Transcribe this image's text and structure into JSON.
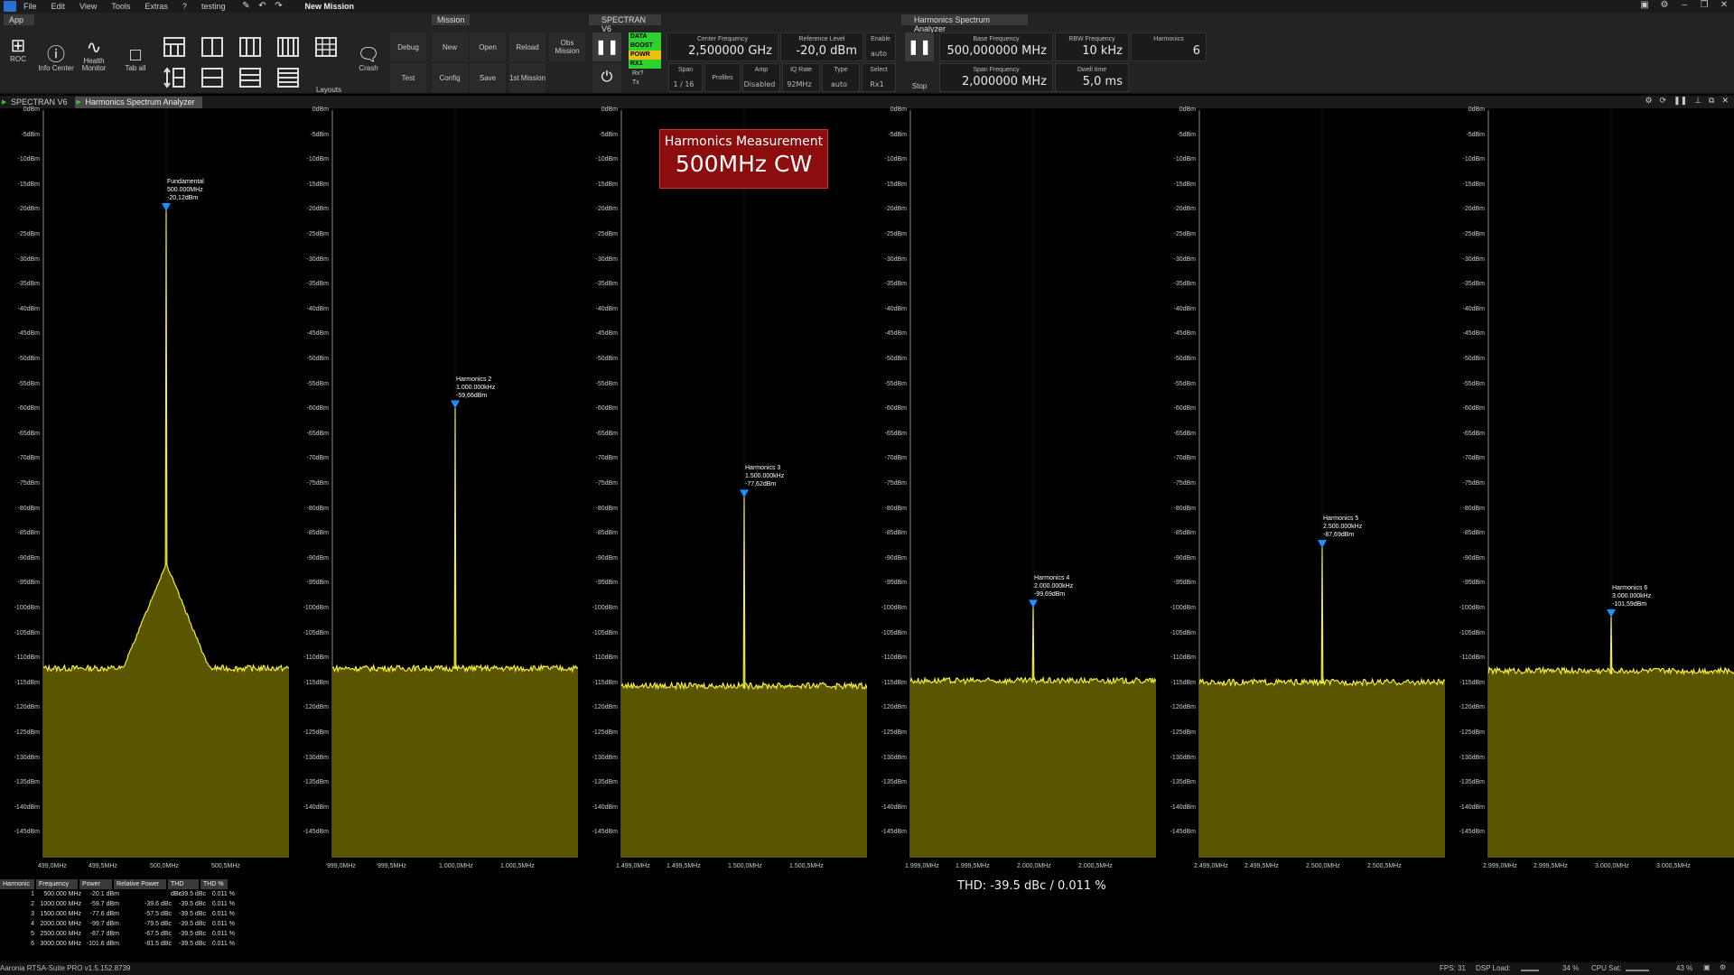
{
  "menu": {
    "items": [
      "File",
      "Edit",
      "View",
      "Tools",
      "Extras",
      "?",
      "testing"
    ],
    "mission_name": "New Mission"
  },
  "toolbar": {
    "app_group": "App",
    "mission_group": "Mission",
    "spectran_group": "SPECTRAN V6",
    "harmonics_group": "Harmonics Spectrum Analyzer",
    "app_buttons": [
      {
        "label": "ROC",
        "icon": "network-icon"
      },
      {
        "label": "Info Center",
        "icon": "info-icon"
      },
      {
        "label": "Health Monitor",
        "icon": "pulse-icon"
      },
      {
        "label": "Tab all",
        "icon": "single-layout-icon"
      }
    ],
    "layout_label": "Layouts",
    "crash_label": "Crash",
    "debug_label": "Debug",
    "test_label": "Test",
    "mission_buttons": [
      "New",
      "Open",
      "Reload",
      "Obs Mission",
      "Config",
      "Save",
      "1st Mission"
    ],
    "status_leds": [
      {
        "label": "DATA",
        "color": "#2fd12f"
      },
      {
        "label": "BOOST",
        "color": "#2fd12f"
      },
      {
        "label": "POWR",
        "color": "#e8c20d"
      },
      {
        "label": "RX1",
        "color": "#2fd12f"
      }
    ],
    "rx_label": "Rx?",
    "tx_label": "Tx",
    "center_frequency": {
      "label": "Center Frequency",
      "value": "2,500000 GHz"
    },
    "reference_level": {
      "label": "Reference Level",
      "value": "-20,0 dBm"
    },
    "enable": {
      "label": "Enable",
      "value": "auto"
    },
    "span": {
      "label": "Span",
      "value": "1 / 16"
    },
    "profiles": {
      "label": "Profiles"
    },
    "amp": {
      "label": "Amp",
      "value": "Disabled"
    },
    "iq_rate": {
      "label": "IQ Rate",
      "value": "92MHz"
    },
    "type": {
      "label": "Type",
      "value": "auto"
    },
    "select": {
      "label": "Select",
      "value": "Rx1"
    },
    "stop_label": "Stop",
    "base_frequency": {
      "label": "Base Frequency",
      "value": "500,000000 MHz"
    },
    "rbw_frequency": {
      "label": "RBW Frequency",
      "value": "10 kHz"
    },
    "harmonics": {
      "label": "Harmonics",
      "value": "6"
    },
    "span_frequency": {
      "label": "Span Frequency",
      "value": "2,000000 MHz"
    },
    "dwell_time": {
      "label": "Dwell time",
      "value": "5,0 ms"
    }
  },
  "tabs": [
    {
      "label": "SPECTRAN V6"
    },
    {
      "label": "Harmonics Spectrum Analyzer"
    }
  ],
  "overlay": {
    "line1": "Harmonics Measurement",
    "line2": "500MHz CW"
  },
  "thd_text": "THD: -39.5 dBc / 0.011 %",
  "table": {
    "headers": [
      "Harmonic",
      "Frequency",
      "Power",
      "Relative Power",
      "THD dBc",
      "THD %"
    ],
    "rows": [
      [
        "1",
        "500.000 MHz",
        "-20.1 dBm",
        "",
        "-39.5 dBc",
        "0.011 %"
      ],
      [
        "2",
        "1000.000 MHz",
        "-59.7 dBm",
        "-39.6 dBc",
        "-39.5 dBc",
        "0.011 %"
      ],
      [
        "3",
        "1500.000 MHz",
        "-77.6 dBm",
        "-57.5 dBc",
        "-39.5 dBc",
        "0.011 %"
      ],
      [
        "4",
        "2000.000 MHz",
        "-99.7 dBm",
        "-79.5 dBc",
        "-39.5 dBc",
        "0.011 %"
      ],
      [
        "5",
        "2500.000 MHz",
        "-87.7 dBm",
        "-67.5 dBc",
        "-39.5 dBc",
        "0.011 %"
      ],
      [
        "6",
        "3000.000 MHz",
        "-101.6 dBm",
        "-81.5 dBc",
        "-39.5 dBc",
        "0.011 %"
      ]
    ]
  },
  "status": {
    "version": "Aaronia RTSA-Suite PRO v1.5.152.8739",
    "fps": "FPS: 31",
    "dsp_label": "DSP Load:",
    "dsp_value": "34 %",
    "dsp_fraction": 0.34,
    "cpu_label": "CPU Sat:",
    "cpu_value": "43 %",
    "cpu_fraction": 0.43
  },
  "plot_style": {
    "trace": "#f2ee3a",
    "fill": "#5a5500",
    "marker": "#1e90ff",
    "grid": "#3a3a3a"
  },
  "chart_data": [
    {
      "type": "line",
      "ylim": [
        -150,
        0
      ],
      "yticks": [
        "0dBm",
        "-5dBm",
        "-10dBm",
        "-15dBm",
        "-20dBm",
        "-25dBm",
        "-30dBm",
        "-35dBm",
        "-40dBm",
        "-45dBm",
        "-50dBm",
        "-55dBm",
        "-60dBm",
        "-65dBm",
        "-70dBm",
        "-75dBm",
        "-80dBm",
        "-85dBm",
        "-90dBm",
        "-95dBm",
        "-100dBm",
        "-105dBm",
        "-110dBm",
        "-115dBm",
        "-120dBm",
        "-125dBm",
        "-130dBm",
        "-135dBm",
        "-140dBm",
        "-145dBm"
      ],
      "xticks": [
        "499,0MHz",
        "499,5MHz",
        "500,0MHz",
        "500,5MHz"
      ],
      "xlim": [
        499,
        501
      ],
      "noise_floor": -112,
      "peak_x": 500.0,
      "peak_y": -20.1,
      "skirt": true,
      "marker": {
        "name": "Fundamental",
        "freq": "500.000MHz",
        "level": "-20,12dBm"
      }
    },
    {
      "type": "line",
      "ylim": [
        -150,
        0
      ],
      "yticks": [
        "0dBm",
        "-5dBm",
        "-10dBm",
        "-15dBm",
        "-20dBm",
        "-25dBm",
        "-30dBm",
        "-35dBm",
        "-40dBm",
        "-45dBm",
        "-50dBm",
        "-55dBm",
        "-60dBm",
        "-65dBm",
        "-70dBm",
        "-75dBm",
        "-80dBm",
        "-85dBm",
        "-90dBm",
        "-95dBm",
        "-100dBm",
        "-105dBm",
        "-110dBm",
        "-115dBm",
        "-120dBm",
        "-125dBm",
        "-130dBm",
        "-135dBm",
        "-140dBm",
        "-145dBm"
      ],
      "xticks": [
        "999,0MHz",
        "999,5MHz",
        "1.000,0MHz",
        "1.000,5MHz"
      ],
      "xlim": [
        999,
        1001
      ],
      "noise_floor": -112,
      "peak_x": 1000.0,
      "peak_y": -59.7,
      "skirt": false,
      "marker": {
        "name": "Harmonics 2",
        "freq": "1.000.000kHz",
        "level": "-59,66dBm"
      }
    },
    {
      "type": "line",
      "ylim": [
        -150,
        0
      ],
      "yticks": [
        "0dBm",
        "-5dBm",
        "-10dBm",
        "-15dBm",
        "-20dBm",
        "-25dBm",
        "-30dBm",
        "-35dBm",
        "-40dBm",
        "-45dBm",
        "-50dBm",
        "-55dBm",
        "-60dBm",
        "-65dBm",
        "-70dBm",
        "-75dBm",
        "-80dBm",
        "-85dBm",
        "-90dBm",
        "-95dBm",
        "-100dBm",
        "-105dBm",
        "-110dBm",
        "-115dBm",
        "-120dBm",
        "-125dBm",
        "-130dBm",
        "-135dBm",
        "-140dBm",
        "-145dBm"
      ],
      "xticks": [
        "1.499,0MHz",
        "1.499,5MHz",
        "1.500,0MHz",
        "1.500,5MHz"
      ],
      "xlim": [
        1499,
        1501
      ],
      "noise_floor": -115.5,
      "peak_x": 1500.0,
      "peak_y": -77.6,
      "skirt": false,
      "marker": {
        "name": "Harmonics 3",
        "freq": "1.500.000kHz",
        "level": "-77,62dBm"
      }
    },
    {
      "type": "line",
      "ylim": [
        -150,
        0
      ],
      "yticks": [
        "0dBm",
        "-5dBm",
        "-10dBm",
        "-15dBm",
        "-20dBm",
        "-25dBm",
        "-30dBm",
        "-35dBm",
        "-40dBm",
        "-45dBm",
        "-50dBm",
        "-55dBm",
        "-60dBm",
        "-65dBm",
        "-70dBm",
        "-75dBm",
        "-80dBm",
        "-85dBm",
        "-90dBm",
        "-95dBm",
        "-100dBm",
        "-105dBm",
        "-110dBm",
        "-115dBm",
        "-120dBm",
        "-125dBm",
        "-130dBm",
        "-135dBm",
        "-140dBm",
        "-145dBm"
      ],
      "xticks": [
        "1.999,0MHz",
        "1.999,5MHz",
        "2.000,0MHz",
        "2.000,5MHz"
      ],
      "xlim": [
        1999,
        2001
      ],
      "noise_floor": -114.5,
      "peak_x": 2000.0,
      "peak_y": -99.7,
      "skirt": false,
      "marker": {
        "name": "Harmonics 4",
        "freq": "2.000.000kHz",
        "level": "-99,69dBm"
      }
    },
    {
      "type": "line",
      "ylim": [
        -150,
        0
      ],
      "yticks": [
        "0dBm",
        "-5dBm",
        "-10dBm",
        "-15dBm",
        "-20dBm",
        "-25dBm",
        "-30dBm",
        "-35dBm",
        "-40dBm",
        "-45dBm",
        "-50dBm",
        "-55dBm",
        "-60dBm",
        "-65dBm",
        "-70dBm",
        "-75dBm",
        "-80dBm",
        "-85dBm",
        "-90dBm",
        "-95dBm",
        "-100dBm",
        "-105dBm",
        "-110dBm",
        "-115dBm",
        "-120dBm",
        "-125dBm",
        "-130dBm",
        "-135dBm",
        "-140dBm",
        "-145dBm"
      ],
      "xticks": [
        "2.499,0MHz",
        "2.499,5MHz",
        "2.500,0MHz",
        "2.500,5MHz"
      ],
      "xlim": [
        2499,
        2501
      ],
      "noise_floor": -114.8,
      "peak_x": 2500.0,
      "peak_y": -87.7,
      "skirt": false,
      "marker": {
        "name": "Harmonics 5",
        "freq": "2.500.000kHz",
        "level": "-87,69dBm"
      }
    },
    {
      "type": "line",
      "ylim": [
        -150,
        0
      ],
      "yticks": [
        "0dBm",
        "-5dBm",
        "-10dBm",
        "-15dBm",
        "-20dBm",
        "-25dBm",
        "-30dBm",
        "-35dBm",
        "-40dBm",
        "-45dBm",
        "-50dBm",
        "-55dBm",
        "-60dBm",
        "-65dBm",
        "-70dBm",
        "-75dBm",
        "-80dBm",
        "-85dBm",
        "-90dBm",
        "-95dBm",
        "-100dBm",
        "-105dBm",
        "-110dBm",
        "-115dBm",
        "-120dBm",
        "-125dBm",
        "-130dBm",
        "-135dBm",
        "-140dBm",
        "-145dBm"
      ],
      "xticks": [
        "2.999,0MHz",
        "2.999,5MHz",
        "3.000,0MHz",
        "3.000,5MHz"
      ],
      "xlim": [
        2999,
        3001
      ],
      "noise_floor": -112.5,
      "peak_x": 3000.0,
      "peak_y": -101.6,
      "skirt": false,
      "marker": {
        "name": "Harmonics 6",
        "freq": "3.000.000kHz",
        "level": "-101,59dBm"
      }
    }
  ]
}
